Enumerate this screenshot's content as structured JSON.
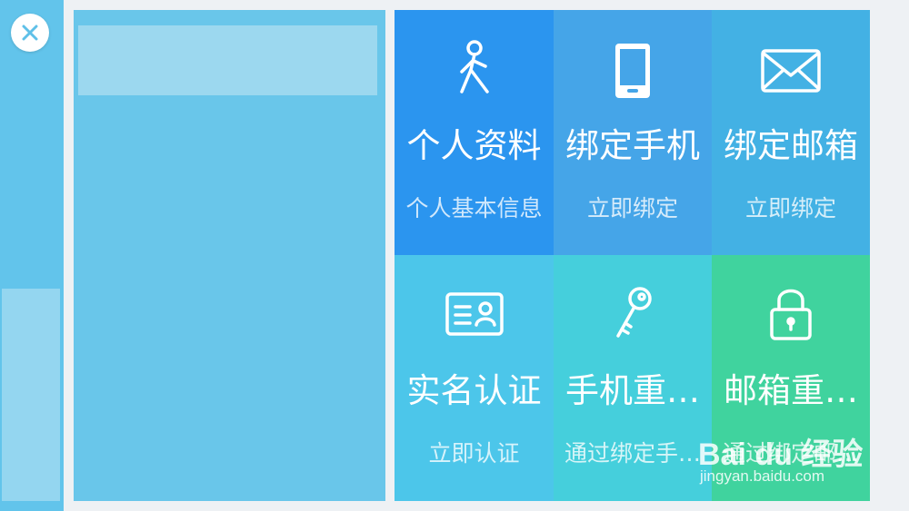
{
  "close": {
    "icon": "close-icon"
  },
  "tiles": [
    {
      "title": "个人资料",
      "subtitle": "个人基本信息",
      "icon": "person-icon",
      "color": "#2b95ef"
    },
    {
      "title": "绑定手机",
      "subtitle": "立即绑定",
      "icon": "phone-icon",
      "color": "#45a5e8"
    },
    {
      "title": "绑定邮箱",
      "subtitle": "立即绑定",
      "icon": "mail-icon",
      "color": "#43b1e4"
    },
    {
      "title": "实名认证",
      "subtitle": "立即认证",
      "icon": "id-card-icon",
      "color": "#4cc6ea"
    },
    {
      "title": "手机重…",
      "subtitle": "通过绑定手…",
      "icon": "key-icon",
      "color": "#45cfdc"
    },
    {
      "title": "邮箱重…",
      "subtitle": "通过绑定邮…",
      "icon": "lock-icon",
      "color": "#40d39e"
    }
  ],
  "watermark": {
    "brand": "Bai du 经验",
    "url": "jingyan.baidu.com"
  }
}
